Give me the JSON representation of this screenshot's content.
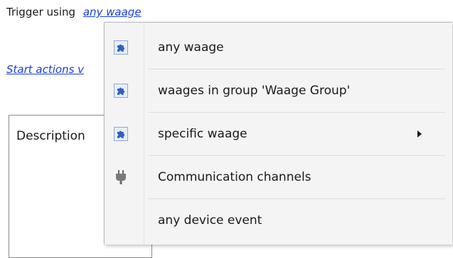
{
  "trigger": {
    "label": "Trigger using",
    "link_value": "any waage"
  },
  "actions": {
    "link_text": "Start actions v"
  },
  "description": {
    "label": "Description"
  },
  "menu": {
    "items": [
      {
        "label": "any waage",
        "icon": "puzzle-icon",
        "has_submenu": false
      },
      {
        "label": "waages in group 'Waage Group'",
        "icon": "puzzle-icon",
        "has_submenu": false
      },
      {
        "label": "specific waage",
        "icon": "puzzle-icon",
        "has_submenu": true
      },
      {
        "label": "Communication channels",
        "icon": "plug-icon",
        "has_submenu": false
      },
      {
        "label": "any device event",
        "icon": "",
        "has_submenu": false
      }
    ]
  },
  "colors": {
    "link": "#1a3fd6",
    "menu_background": "#f4f4f4",
    "icon_blue": "#2f5fc4"
  }
}
